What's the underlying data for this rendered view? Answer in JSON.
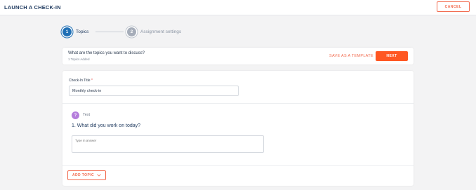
{
  "header": {
    "title": "LAUNCH A CHECK-IN",
    "cancel_label": "CANCEL"
  },
  "stepper": {
    "steps": [
      {
        "number": "1",
        "label": "Topics"
      },
      {
        "number": "2",
        "label": "Assignment settings"
      }
    ]
  },
  "topics_bar": {
    "question": "What are the topics you want to discuss?",
    "count": "1 Topics Added",
    "save_template_label": "SAVE AS A TEMPLATE",
    "next_label": "NEXT"
  },
  "checkin": {
    "title_label": "Check-In Title",
    "required_mark": "*",
    "title_value": "Monthly check-in"
  },
  "topic": {
    "type_badge": "?",
    "type_label": "Text",
    "question": "1. What did you work on today?",
    "answer_placeholder": "Type in answer"
  },
  "footer": {
    "add_topic_label": "ADD TOPIC"
  },
  "colors": {
    "accent": "#ff5722",
    "primary": "#1f6fb5",
    "badge": "#b57edc"
  }
}
